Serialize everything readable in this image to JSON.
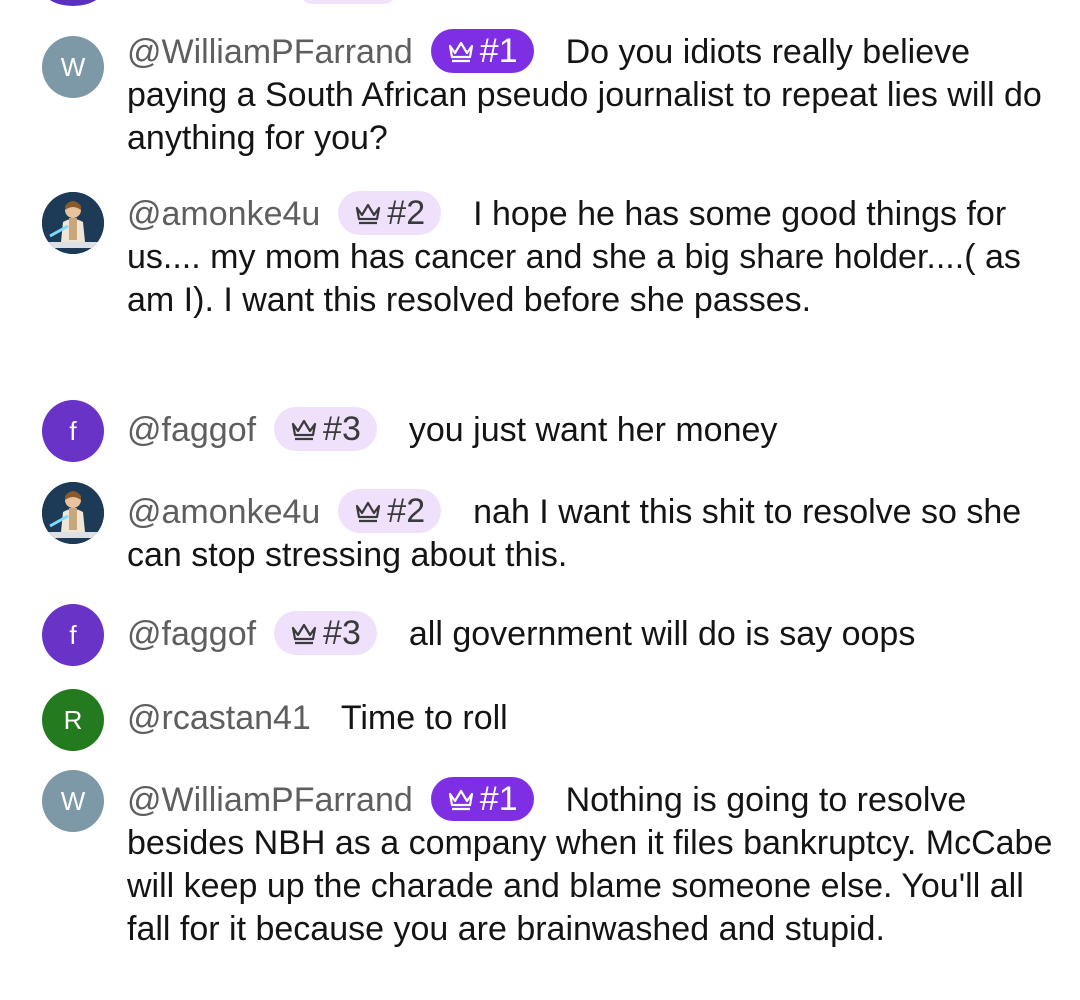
{
  "colors": {
    "avatar_w": "#7d98a6",
    "avatar_f": "#6a33c7",
    "avatar_r": "#237a1f",
    "badge_rank1_bg": "#7e2fe4",
    "badge_rank_other_bg": "#efe1fb",
    "handle_text": "#5e5e5e"
  },
  "messages": [
    {
      "avatar_letter": "W",
      "handle": "@WilliamPFarrand",
      "rank": "#1",
      "text": "Do you idiots really believe paying a South African pseudo journalist to repeat lies will do anything for you?"
    },
    {
      "avatar_letter": "",
      "handle": "@amonke4u",
      "rank": "#2",
      "text": "I hope he has some good things for us.... my mom has cancer and she a big share holder....( as am I). I want this resolved before she passes."
    },
    {
      "avatar_letter": "f",
      "handle": "@faggof",
      "rank": "#3",
      "text": "you just want her money"
    },
    {
      "avatar_letter": "",
      "handle": "@amonke4u",
      "rank": "#2",
      "text": "nah I want this shit to resolve so she can stop stressing about this."
    },
    {
      "avatar_letter": "f",
      "handle": "@faggof",
      "rank": "#3",
      "text": "all government will do is say oops"
    },
    {
      "avatar_letter": "R",
      "handle": "@rcastan41",
      "rank": "",
      "text": "Time to roll"
    },
    {
      "avatar_letter": "W",
      "handle": "@WilliamPFarrand",
      "rank": "#1",
      "text": "Nothing is going to resolve besides NBH as a company when it files bankruptcy. McCabe will keep up the charade and blame someone else. You'll all fall for it because you are brainwashed and stupid."
    }
  ]
}
